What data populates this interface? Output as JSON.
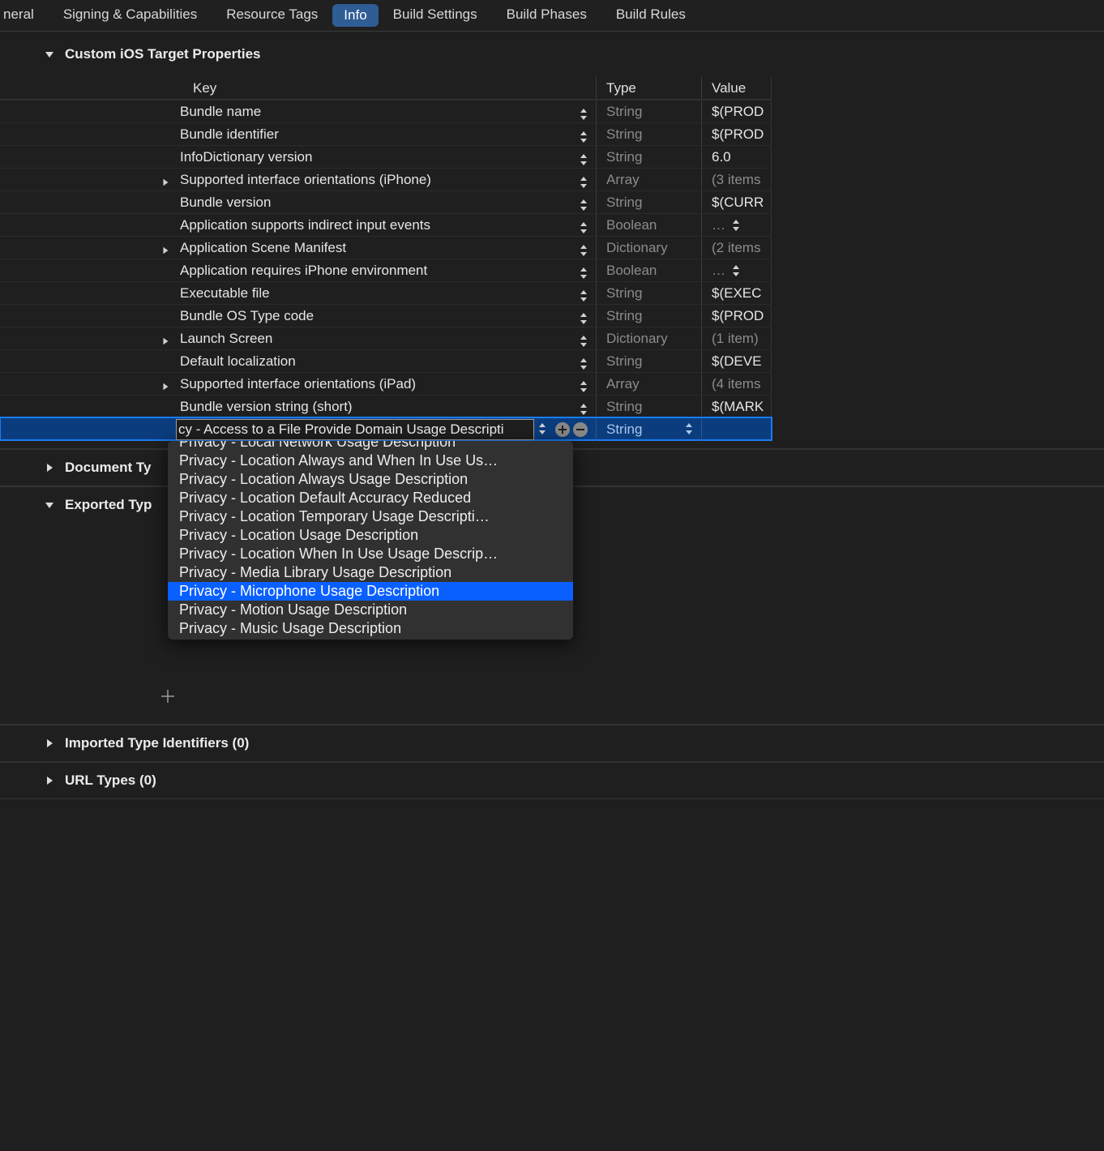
{
  "tabs": {
    "general": "neral",
    "signing": "Signing & Capabilities",
    "resource": "Resource Tags",
    "info": "Info",
    "build_settings": "Build Settings",
    "build_phases": "Build Phases",
    "build_rules": "Build Rules"
  },
  "sections": {
    "custom_ios": "Custom iOS Target Properties",
    "document_types": "Document Ty",
    "exported_types": "Exported Typ",
    "imported_types": "Imported Type Identifiers (0)",
    "url_types": "URL Types (0)"
  },
  "columns": {
    "key": "Key",
    "type": "Type",
    "value": "Value"
  },
  "rows": [
    {
      "key": "Bundle name",
      "type": "String",
      "value": "$(PROD",
      "expandable": false
    },
    {
      "key": "Bundle identifier",
      "type": "String",
      "value": "$(PROD",
      "expandable": false
    },
    {
      "key": "InfoDictionary version",
      "type": "String",
      "value": "6.0",
      "expandable": false
    },
    {
      "key": "Supported interface orientations (iPhone)",
      "type": "Array",
      "value": "(3 items",
      "expandable": true,
      "dim": true
    },
    {
      "key": "Bundle version",
      "type": "String",
      "value": "$(CURR",
      "expandable": false
    },
    {
      "key": "Application supports indirect input events",
      "type": "Boolean",
      "value": "…",
      "expandable": false,
      "dim": true,
      "value_stepper": true
    },
    {
      "key": "Application Scene Manifest",
      "type": "Dictionary",
      "value": "(2 items",
      "expandable": true,
      "dim": true
    },
    {
      "key": "Application requires iPhone environment",
      "type": "Boolean",
      "value": "…",
      "expandable": false,
      "dim": true,
      "value_stepper": true
    },
    {
      "key": "Executable file",
      "type": "String",
      "value": "$(EXEC",
      "expandable": false
    },
    {
      "key": "Bundle OS Type code",
      "type": "String",
      "value": "$(PROD",
      "expandable": false
    },
    {
      "key": "Launch Screen",
      "type": "Dictionary",
      "value": "(1 item)",
      "expandable": true,
      "dim": true
    },
    {
      "key": "Default localization",
      "type": "String",
      "value": "$(DEVE",
      "expandable": false
    },
    {
      "key": "Supported interface orientations (iPad)",
      "type": "Array",
      "value": "(4 items",
      "expandable": true,
      "dim": true
    },
    {
      "key": "Bundle version string (short)",
      "type": "String",
      "value": "$(MARK",
      "expandable": false
    }
  ],
  "editing": {
    "text": "cy - Access to a File Provide Domain Usage Descripti",
    "type": "String"
  },
  "dropdown": [
    "Privacy - Local Network Usage Description",
    "Privacy - Location Always and When In Use Us…",
    "Privacy - Location Always Usage Description",
    "Privacy - Location Default Accuracy Reduced",
    "Privacy - Location Temporary Usage Descripti…",
    "Privacy - Location Usage Description",
    "Privacy - Location When In Use Usage Descrip…",
    "Privacy - Media Library Usage Description",
    "Privacy - Microphone Usage Description",
    "Privacy - Motion Usage Description",
    "Privacy - Music Usage Description"
  ],
  "dropdown_selected_index": 8
}
